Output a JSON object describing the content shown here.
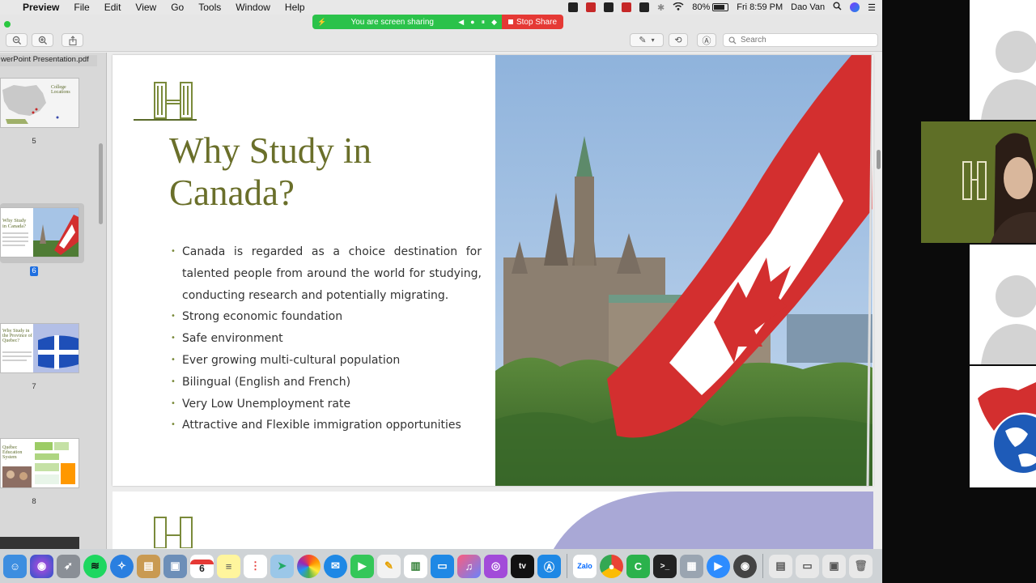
{
  "menubar": {
    "app": "Preview",
    "items": [
      "File",
      "Edit",
      "View",
      "Go",
      "Tools",
      "Window",
      "Help"
    ],
    "battery": "80%",
    "battery_level": 0.8,
    "clock": "Fri 8:59 PM",
    "user": "Dao Van"
  },
  "share": {
    "status": "You are screen sharing",
    "stop_label": "Stop Share"
  },
  "toolbar": {
    "search_placeholder": "Search"
  },
  "sidebar": {
    "doc_title": "werPoint Presentation.pdf",
    "pages": [
      {
        "num": "5",
        "label": "College Locations"
      },
      {
        "num": "6",
        "label": "Why Study in Canada?",
        "selected": true
      },
      {
        "num": "7",
        "label": "Why Study in the Province of Quebec?"
      },
      {
        "num": "8",
        "label": "Québec Education System"
      }
    ]
  },
  "slide": {
    "title_line1": "Why Study in",
    "title_line2": "Canada?",
    "bullets": [
      "Canada is regarded as a choice destination for talented people from around the world for studying, conducting research and potentially migrating.",
      "Strong economic foundation",
      "Safe environment",
      "Ever growing multi-cultural population",
      "Bilingual (English and French)",
      "Very Low Unemployment rate",
      "Attractive and Flexible immigration opportunities"
    ]
  },
  "dock": {
    "calendar_day": "6",
    "zalo_label": "Zalo",
    "tv_label": "tv"
  },
  "colors": {
    "accent_olive": "#6a6f2a",
    "share_green": "#2bc24a",
    "stop_red": "#e53935",
    "selection_blue": "#1f6fe0"
  }
}
